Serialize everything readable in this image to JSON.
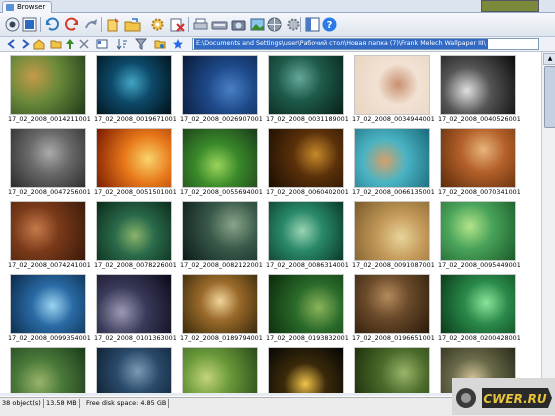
{
  "tab": {
    "label": "Browser"
  },
  "toolbar": {
    "buttons": [
      "back",
      "refresh",
      "undo",
      "redo",
      "copy",
      "move",
      "folder-open",
      "settings",
      "delete",
      "print",
      "scan",
      "camera",
      "image",
      "web",
      "panel",
      "help"
    ]
  },
  "addressbar": {
    "path": "E:\\Documents and Settings\\user\\Рабочий стол\\Новая папка (7)\\Frank Melech Wallpaper III\\"
  },
  "thumbnails": [
    {
      "caption": "17_02_2008_00142110014...",
      "c1": "#1f3a1a",
      "c2": "#6b8a3a",
      "c3": "#c49a4a"
    },
    {
      "caption": "17_02_2008_00196710014...",
      "c1": "#021018",
      "c2": "#0d4a6a",
      "c3": "#42a5c4"
    },
    {
      "caption": "17_02_2008_00269070014...",
      "c1": "#0a1a38",
      "c2": "#1e4a8a",
      "c3": "#4a7fc6"
    },
    {
      "caption": "17_02_2008_00311890014...",
      "c1": "#07201a",
      "c2": "#1e5a4a",
      "c3": "#64a89a"
    },
    {
      "caption": "17_02_2008_00349440014...",
      "c1": "#e8d4c0",
      "c2": "#f2e2d4",
      "c3": "#c89070"
    },
    {
      "caption": "17_02_2008_00405260014...",
      "c1": "#0a0a0a",
      "c2": "#555555",
      "c3": "#e0e0e0"
    },
    {
      "caption": "17_02_2008_00472560014...",
      "c1": "#2a2a2a",
      "c2": "#6a6a6a",
      "c3": "#aaaaaa"
    },
    {
      "caption": "17_02_2008_00515010014...",
      "c1": "#7a1a00",
      "c2": "#e8781a",
      "c3": "#f8d46a"
    },
    {
      "caption": "17_02_2008_00556940014...",
      "c1": "#1a3a1a",
      "c2": "#3a8a2a",
      "c3": "#9ad45a"
    },
    {
      "caption": "17_02_2008_00604020014...",
      "c1": "#1a0e02",
      "c2": "#5a300a",
      "c3": "#c68a2a"
    },
    {
      "caption": "17_02_2008_00661350014...",
      "c1": "#1a6a7a",
      "c2": "#4ab4c4",
      "c3": "#d4a06a"
    },
    {
      "caption": "17_02_2008_00703410014...",
      "c1": "#5a2a0a",
      "c2": "#b4602a",
      "c3": "#e8b47a"
    },
    {
      "caption": "17_02_2008_00742410014...",
      "c1": "#3a1a0a",
      "c2": "#7a3a1a",
      "c3": "#c47a4a"
    },
    {
      "caption": "17_02_2008_00782260014...",
      "c1": "#0a2a1a",
      "c2": "#2a6a4a",
      "c3": "#8ab46a"
    },
    {
      "caption": "17_02_2008_00821220014...",
      "c1": "#0a1a1a",
      "c2": "#3a5a4a",
      "c3": "#8aa48a"
    },
    {
      "caption": "17_02_2008_00863140014...",
      "c1": "#0a3a2a",
      "c2": "#2a8a6a",
      "c3": "#9ad4b4"
    },
    {
      "caption": "17_02_2008_00910870014...",
      "c1": "#7a5a2a",
      "c2": "#c49a5a",
      "c3": "#e8d49a"
    },
    {
      "caption": "17_02_2008_00954490014...",
      "c1": "#1a5a2a",
      "c2": "#4aa45a",
      "c3": "#b4e48a"
    },
    {
      "caption": "17_02_2008_00993540014...",
      "c1": "#0a2a4a",
      "c2": "#2a6aa4",
      "c3": "#9ad4f2"
    },
    {
      "caption": "17_02_2008_01013630014...",
      "c1": "#0a0a1a",
      "c2": "#3a3a5a",
      "c3": "#9a9ab4"
    },
    {
      "caption": "17_02_2008_01897940014...",
      "c1": "#3a2a0a",
      "c2": "#9a6a2a",
      "c3": "#f2d49a"
    },
    {
      "caption": "17_02_2008_01938320014...",
      "c1": "#0a2a0a",
      "c2": "#2a6a2a",
      "c3": "#8ab45a"
    },
    {
      "caption": "17_02_2008_01966510014...",
      "c1": "#2a1a0a",
      "c2": "#6a4a2a",
      "c3": "#b48a5a"
    },
    {
      "caption": "17_02_2008_02004280014...",
      "c1": "#0a3a1a",
      "c2": "#2a8a4a",
      "c3": "#8ae49a"
    },
    {
      "caption": "",
      "c1": "#1a3a1a",
      "c2": "#4a7a3a",
      "c3": "#9ab46a"
    },
    {
      "caption": "",
      "c1": "#0a1a2a",
      "c2": "#2a4a6a",
      "c3": "#7a9ab4"
    },
    {
      "caption": "",
      "c1": "#2a4a1a",
      "c2": "#6a9a3a",
      "c3": "#c4d47a"
    },
    {
      "caption": "",
      "c1": "#050505",
      "c2": "#3a2a0a",
      "c3": "#f2c44a"
    },
    {
      "caption": "",
      "c1": "#1a2a0a",
      "c2": "#4a6a2a",
      "c3": "#9ab46a"
    },
    {
      "caption": "",
      "c1": "#2a2a1a",
      "c2": "#6a6a4a",
      "c3": "#d4c49a"
    }
  ],
  "status": {
    "objects": "38 object(s)",
    "size": "13.58 MB",
    "free": "Free disk space: 4.85 GB"
  },
  "watermark": {
    "text": "CWER.RU"
  }
}
